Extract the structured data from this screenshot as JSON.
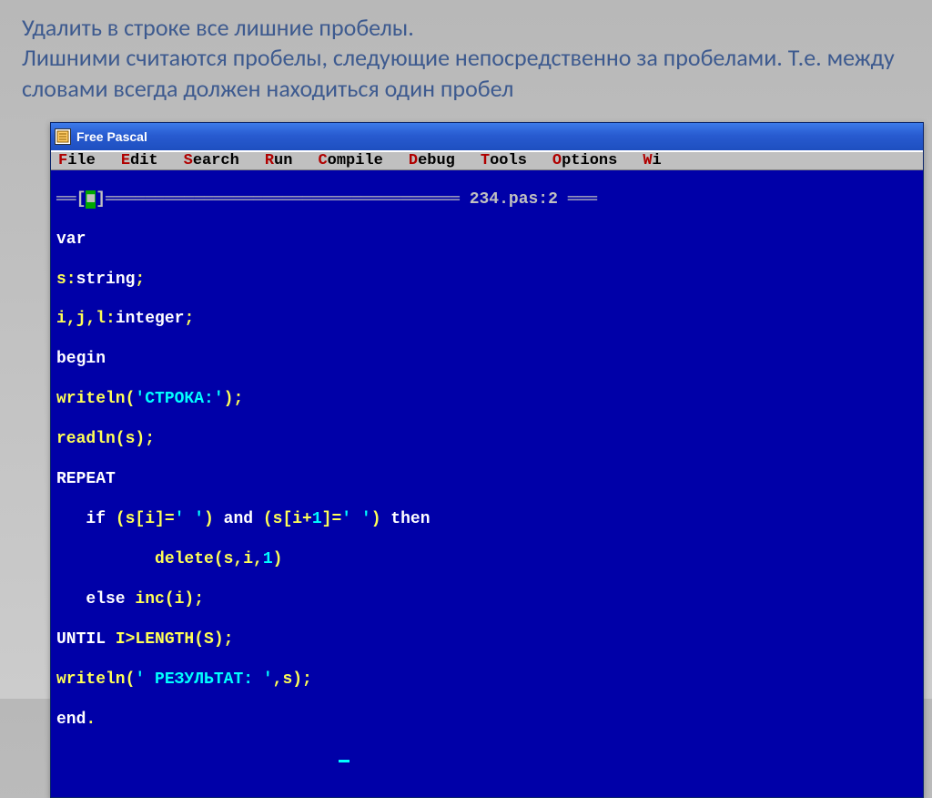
{
  "slide": {
    "title": "Удалить в строке все лишние пробелы.\nЛишними считаются пробелы, следующие непосредственно за пробелами. Т.е. между словами всегда должен находиться один пробел"
  },
  "window": {
    "title": "Free Pascal"
  },
  "menu": {
    "file": {
      "hot": "F",
      "rest": "ile"
    },
    "edit": {
      "hot": "E",
      "rest": "dit"
    },
    "search": {
      "hot": "S",
      "rest": "earch"
    },
    "run": {
      "hot": "R",
      "rest": "un"
    },
    "compile": {
      "hot": "C",
      "rest": "ompile"
    },
    "debug": {
      "hot": "D",
      "rest": "ebug"
    },
    "tools": {
      "hot": "T",
      "rest": "ools"
    },
    "options": {
      "hot": "O",
      "rest": "ptions"
    },
    "window": {
      "hot": "W",
      "rest": "i"
    }
  },
  "editor": {
    "tab_title": "234.pas:2",
    "frame_left": "══[",
    "frame_box": "■",
    "frame_mid_right": "]════════════════════════════════════ ",
    "frame_right": " ═══",
    "code": {
      "l1_a": "var",
      "l2_a": "s:",
      "l2_b": "string",
      "l2_c": ";",
      "l3_a": "i,j,l:",
      "l3_b": "integer",
      "l3_c": ";",
      "l4_a": "begin",
      "l5_a": "writeln(",
      "l5_b": "'СТРОКА:'",
      "l5_c": ");",
      "l6_a": "readln(s);",
      "l7_a": "REPEAT",
      "l8_a": "   if ",
      "l8_b": "(s[i]=",
      "l8_c": "' '",
      "l8_d": ") ",
      "l8_e": "and",
      "l8_f": " (s[i+",
      "l8_g": "1",
      "l8_h": "]=",
      "l8_i": "' '",
      "l8_j": ") ",
      "l8_k": "then",
      "l9_a": "          delete(s,i,",
      "l9_b": "1",
      "l9_c": ")",
      "l10_a": "   else ",
      "l10_b": "inc(i);",
      "l11_a": "UNTIL ",
      "l11_b": "I>LENGTH(S);",
      "l12_a": "writeln(",
      "l12_b": "' РЕЗУЛЬТАТ: '",
      "l12_c": ",s);",
      "l13_a": "end",
      "l13_b": "."
    }
  }
}
